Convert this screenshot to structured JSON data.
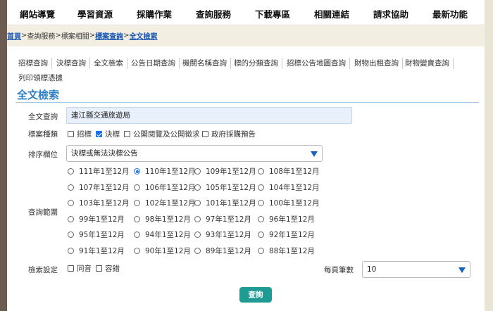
{
  "topnav": {
    "items": [
      "網站導覽",
      "學習資源",
      "採購作業",
      "查詢服務",
      "下載專區",
      "相關連結",
      "請求協助",
      "最新功能"
    ]
  },
  "breadcrumb": {
    "home": "首頁",
    "sep": ">",
    "path1": "查詢服務",
    "path2": "標案相關",
    "path3": "標案查詢",
    "current": "全文檢索"
  },
  "tabs": [
    "招標查詢",
    "決標查詢",
    "全文檢索",
    "公告日期查詢",
    "機關名稱查詢",
    "標的分類查詢",
    "招標公告地圖查詢",
    "財物出租查詢",
    "財物變賣查詢",
    "列印領標憑據"
  ],
  "page_title": "全文檢索",
  "form": {
    "fulltext_label": "全文查詢",
    "fulltext_value": "連江縣交通旅遊局",
    "type_label": "標案種類",
    "types": [
      {
        "label": "招標",
        "checked": false
      },
      {
        "label": "決標",
        "checked": true
      },
      {
        "label": "公開閱覽及公開徵求",
        "checked": false
      },
      {
        "label": "政府採購預告",
        "checked": false
      }
    ],
    "sort_label": "排序欄位",
    "sort_value": "決標或無法決標公告",
    "range_label": "查詢範圍",
    "ranges": [
      {
        "label": "111年1至12月",
        "selected": false
      },
      {
        "label": "110年1至12月",
        "selected": true
      },
      {
        "label": "109年1至12月",
        "selected": false
      },
      {
        "label": "108年1至12月",
        "selected": false
      },
      {
        "label": "107年1至12月",
        "selected": false
      },
      {
        "label": "106年1至12月",
        "selected": false
      },
      {
        "label": "105年1至12月",
        "selected": false
      },
      {
        "label": "104年1至12月",
        "selected": false
      },
      {
        "label": "103年1至12月",
        "selected": false
      },
      {
        "label": "102年1至12月",
        "selected": false
      },
      {
        "label": "101年1至12月",
        "selected": false
      },
      {
        "label": "100年1至12月",
        "selected": false
      },
      {
        "label": "99年1至12月",
        "selected": false
      },
      {
        "label": "98年1至12月",
        "selected": false
      },
      {
        "label": "97年1至12月",
        "selected": false
      },
      {
        "label": "96年1至12月",
        "selected": false
      },
      {
        "label": "95年1至12月",
        "selected": false
      },
      {
        "label": "94年1至12月",
        "selected": false
      },
      {
        "label": "93年1至12月",
        "selected": false
      },
      {
        "label": "92年1至12月",
        "selected": false
      },
      {
        "label": "91年1至12月",
        "selected": false
      },
      {
        "label": "90年1至12月",
        "selected": false
      },
      {
        "label": "89年1至12月",
        "selected": false
      },
      {
        "label": "88年1至12月",
        "selected": false
      }
    ],
    "settings_label": "檢索設定",
    "settings": [
      {
        "label": "同音",
        "checked": false
      },
      {
        "label": "容錯",
        "checked": false
      }
    ],
    "per_page_label": "每頁筆數",
    "per_page_value": "10",
    "search_button": "查詢"
  },
  "colors": {
    "accent": "#2d7fc1",
    "link": "#1a56b4",
    "button": "#1f9b94",
    "input_bg": "#e8f0fb"
  }
}
